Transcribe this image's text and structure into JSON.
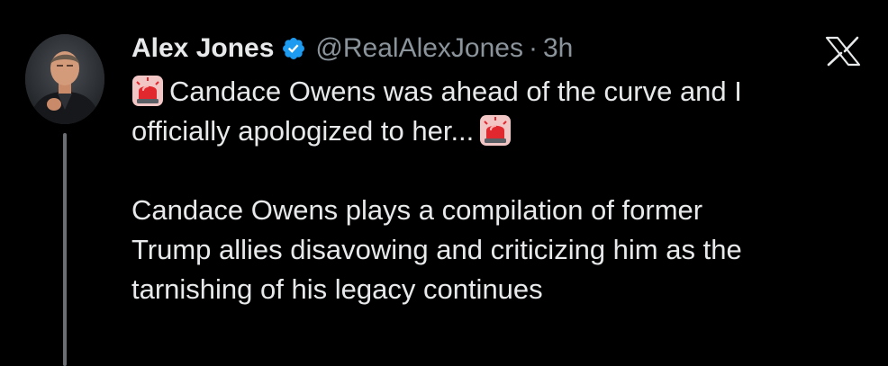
{
  "tweet": {
    "author_name": "Alex Jones",
    "handle": "@RealAlexJones",
    "separator": "·",
    "time": "3h",
    "verified": true,
    "paragraph1": {
      "line1": "Candace Owens was ahead of the curve and I",
      "line2": "officially apologized to her..."
    },
    "paragraph2": {
      "line1": "Candace Owens plays a compilation of former",
      "line2": "Trump allies disavowing and criticizing him as the",
      "line3": "tarnishing of his legacy continues"
    },
    "emoji": "siren-icon",
    "platform_icon": "x-logo-icon"
  },
  "colors": {
    "background": "#000000",
    "text": "#e7e9ea",
    "secondary_text": "#8b949b",
    "verified_blue": "#1d9bf0",
    "thread_line": "#6b6f73"
  }
}
